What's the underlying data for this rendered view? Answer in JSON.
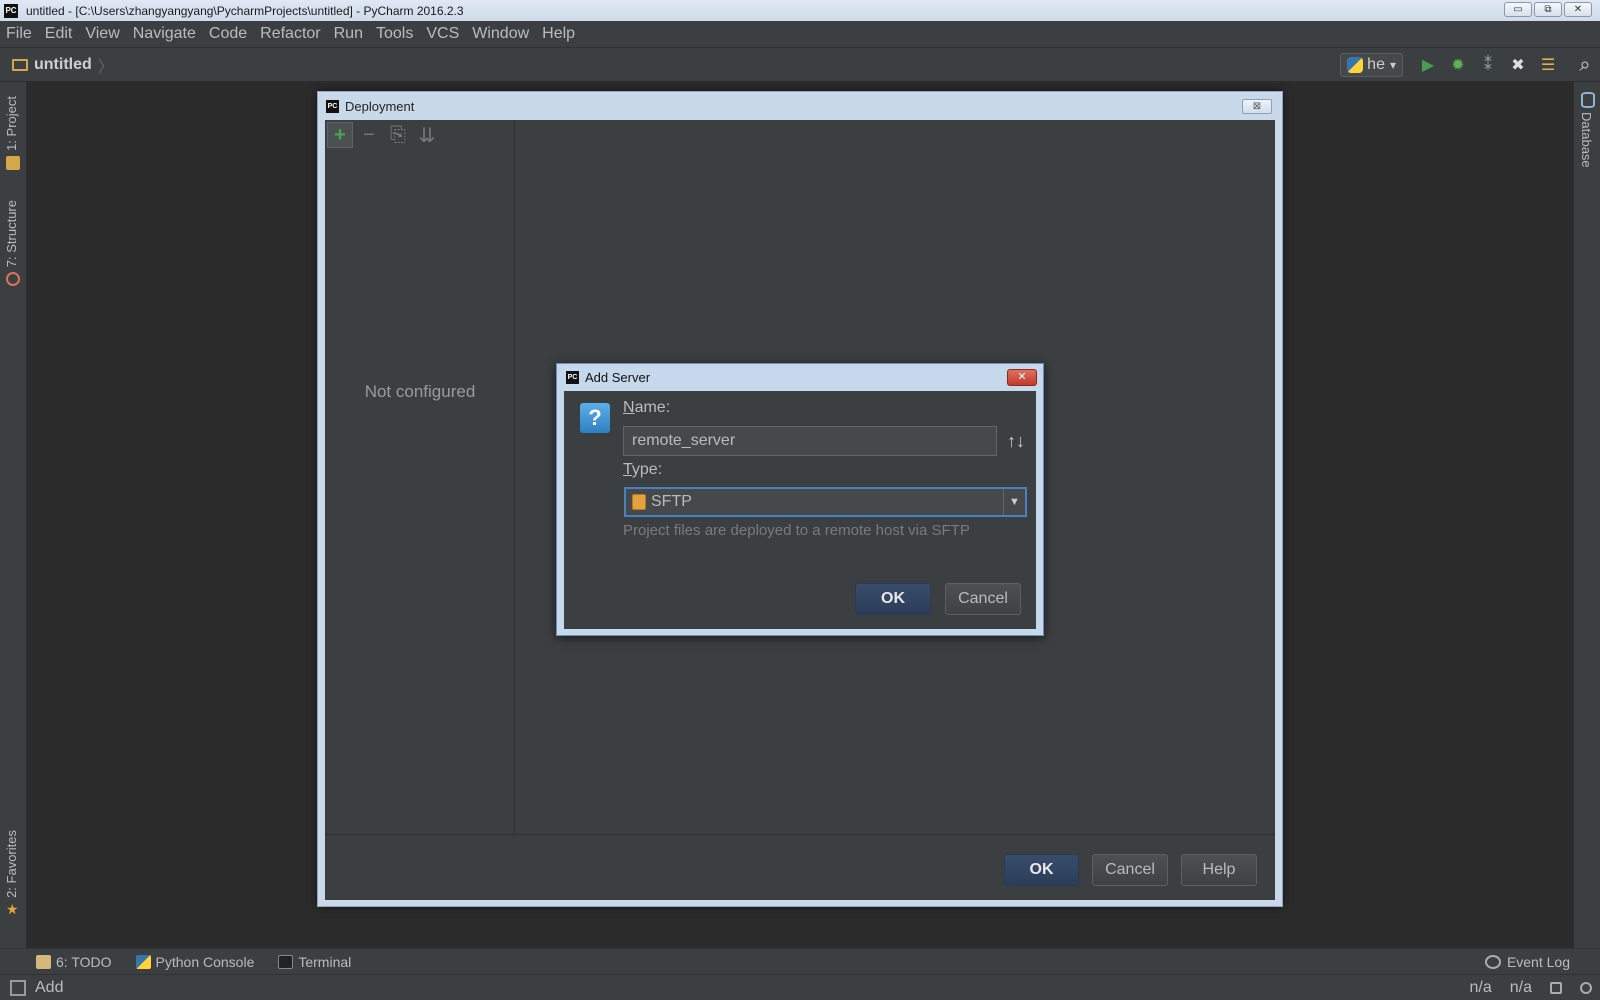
{
  "window": {
    "title": "untitled - [C:\\Users\\zhangyangyang\\PycharmProjects\\untitled] - PyCharm 2016.2.3",
    "app_badge": "PC",
    "minimize": "▭",
    "restore": "⧉",
    "close": "✕"
  },
  "menu": [
    "File",
    "Edit",
    "View",
    "Navigate",
    "Code",
    "Refactor",
    "Run",
    "Tools",
    "VCS",
    "Window",
    "Help"
  ],
  "navbar": {
    "breadcrumb": "untitled",
    "crumb_separator": "〉",
    "run_config": "he",
    "run_config_arrow": "▾"
  },
  "toolbar_icons": {
    "run": "▶",
    "debug": "✹",
    "coverage": "⁑",
    "stop": "✖",
    "tasks": "☰",
    "search": "⌕"
  },
  "left_tabs": {
    "project": "1: Project",
    "structure": "7: Structure",
    "favorites": "2: Favorites",
    "favorites_star": "★"
  },
  "right_tabs": {
    "database": "Database"
  },
  "bottom_tabs": {
    "todo": "6: TODO",
    "python_console": "Python Console",
    "terminal": "Terminal",
    "event_log": "Event Log"
  },
  "status": {
    "text": "Add",
    "pos1": "n/a",
    "pos2": "n/a"
  },
  "deployment": {
    "title": "Deployment",
    "close_glyph": "⊠",
    "toolbar": {
      "add": "+",
      "remove": "−",
      "copy": "⎘",
      "move": "⇊"
    },
    "not_configured": "Not configured",
    "ok": "OK",
    "cancel": "Cancel",
    "help": "Help"
  },
  "add_server": {
    "title": "Add Server",
    "close_glyph": "✕",
    "question_glyph": "?",
    "name_label_accel": "N",
    "name_label_rest": "ame:",
    "name_value": "remote_server",
    "sort_glyph": "↑↓",
    "type_label_accel": "T",
    "type_label_rest": "ype:",
    "type_value": "SFTP",
    "type_arrow": "▼",
    "description": "Project files are deployed to a remote host via SFTP",
    "ok": "OK",
    "cancel": "Cancel"
  },
  "colors": {
    "ide_bg": "#2b2b2b",
    "panel_bg": "#3c3f41",
    "accent_blue": "#4a7fc4",
    "run_green": "#499c54",
    "primary_button": "#365880"
  }
}
